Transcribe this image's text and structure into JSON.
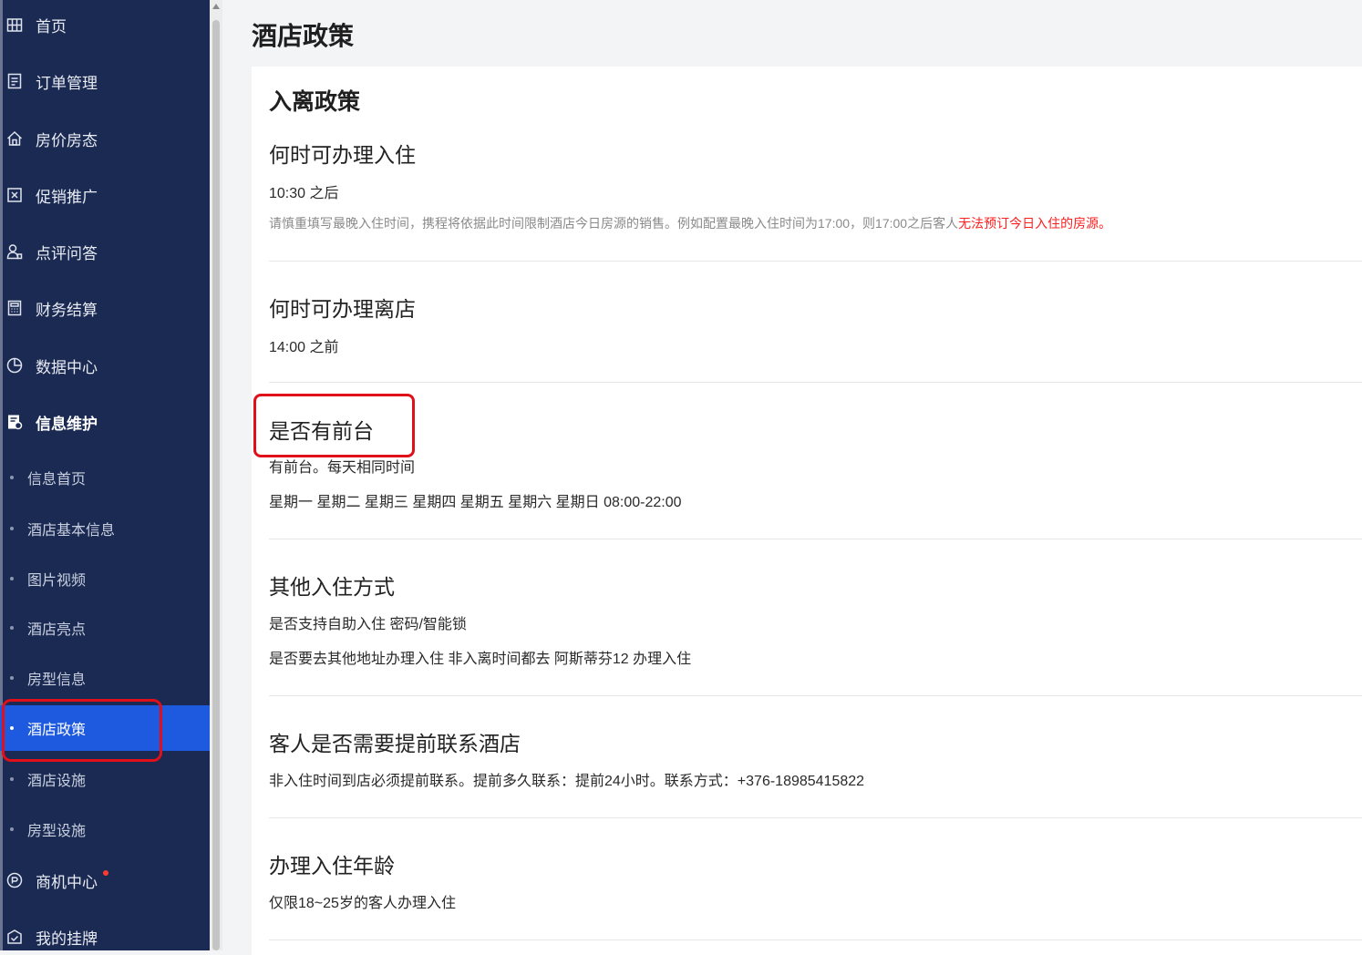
{
  "page": {
    "title": "酒店政策"
  },
  "sidebar": {
    "items": [
      {
        "label": "首页",
        "icon": "home-grid-icon"
      },
      {
        "label": "订单管理",
        "icon": "document-list-icon"
      },
      {
        "label": "房价房态",
        "icon": "house-icon"
      },
      {
        "label": "促销推广",
        "icon": "promo-ticket-icon"
      },
      {
        "label": "点评问答",
        "icon": "user-review-icon"
      },
      {
        "label": "财务结算",
        "icon": "calculator-icon"
      },
      {
        "label": "数据中心",
        "icon": "pie-chart-icon"
      },
      {
        "label": "信息维护",
        "icon": "edit-document-icon"
      }
    ],
    "sub_items": [
      {
        "label": "信息首页"
      },
      {
        "label": "酒店基本信息"
      },
      {
        "label": "图片视频"
      },
      {
        "label": "酒店亮点"
      },
      {
        "label": "房型信息"
      },
      {
        "label": "酒店政策",
        "active": true
      },
      {
        "label": "酒店设施"
      },
      {
        "label": "房型设施"
      }
    ],
    "bottom_items": [
      {
        "label": "商机中心",
        "icon": "opportunity-icon",
        "has_badge": true
      },
      {
        "label": "我的挂牌",
        "icon": "badge-check-icon"
      }
    ]
  },
  "policy": {
    "section_title": "入离政策",
    "checkin": {
      "question": "何时可办理入住",
      "answer": "10:30 之后",
      "note": "请慎重填写最晚入住时间，携程将依据此时间限制酒店今日房源的销售。例如配置最晚入住时间为17:00，则17:00之后客人",
      "note_warning": "无法预订今日入住的房源。"
    },
    "checkout": {
      "question": "何时可办理离店",
      "answer": "14:00 之前"
    },
    "front_desk": {
      "question": "是否有前台",
      "answer": "有前台。每天相同时间",
      "hours": "星期一 星期二 星期三 星期四 星期五 星期六 星期日 08:00-22:00"
    },
    "other_checkin": {
      "question": "其他入住方式",
      "line1": "是否支持自助入住 密码/智能锁",
      "line2": "是否要去其他地址办理入住 非入离时间都去 阿斯蒂芬12 办理入住"
    },
    "contact": {
      "question": "客人是否需要提前联系酒店",
      "answer": "非入住时间到店必须提前联系。提前多久联系：提前24小时。联系方式：+376-18985415822"
    },
    "age": {
      "question": "办理入住年龄",
      "answer": "仅限18~25岁的客人办理入住"
    }
  },
  "colors": {
    "sidebar_bg": "#1b2a52",
    "active_bg": "#1e5ae0",
    "highlight": "#e0101a",
    "warning_text": "#ff1e1e"
  }
}
